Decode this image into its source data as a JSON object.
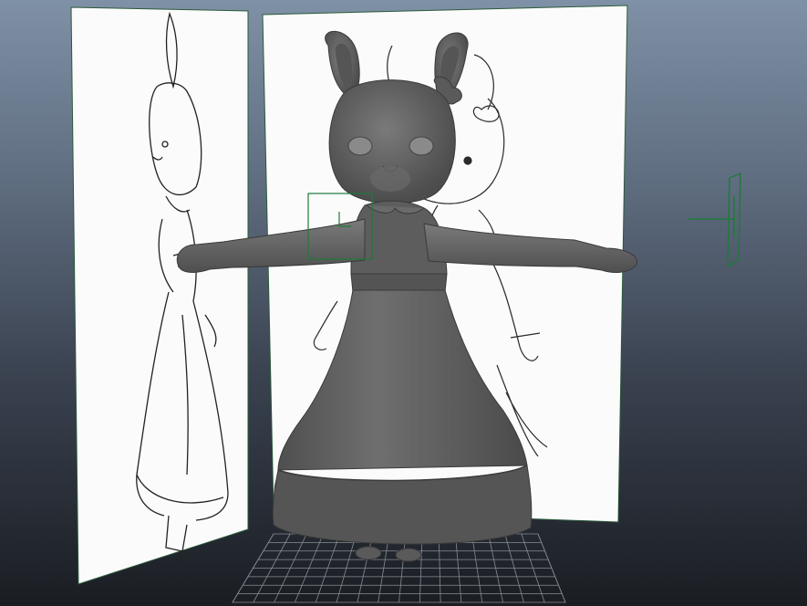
{
  "app": {
    "view": "3d-viewport"
  },
  "scene": {
    "character": "rabbit-in-dress-model",
    "reference_planes": [
      "side-reference-image-plane",
      "front-reference-image-plane"
    ],
    "icons": [
      "manipulator-icon"
    ]
  },
  "colors": {
    "bg_top": "#7f91a6",
    "bg_bottom": "#1a1d22",
    "model_gray": "#5c5c5c",
    "grid": "#9aa0a8",
    "selection_green": "#1e7a3a",
    "reference_paper": "#fbfbfb"
  }
}
